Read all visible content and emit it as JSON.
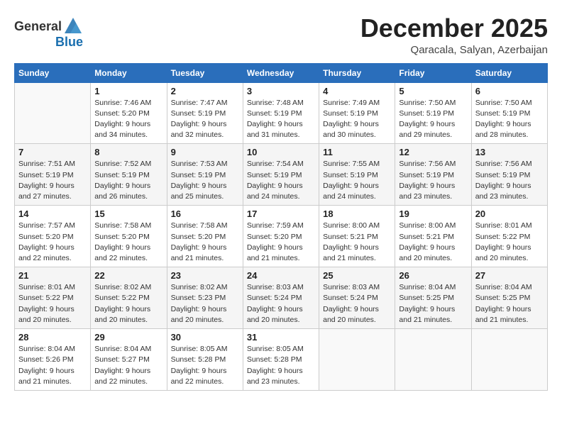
{
  "header": {
    "logo_general": "General",
    "logo_blue": "Blue",
    "month_title": "December 2025",
    "location": "Qaracala, Salyan, Azerbaijan"
  },
  "days_of_week": [
    "Sunday",
    "Monday",
    "Tuesday",
    "Wednesday",
    "Thursday",
    "Friday",
    "Saturday"
  ],
  "weeks": [
    {
      "days": [
        {
          "num": "",
          "info": ""
        },
        {
          "num": "1",
          "info": "Sunrise: 7:46 AM\nSunset: 5:20 PM\nDaylight: 9 hours\nand 34 minutes."
        },
        {
          "num": "2",
          "info": "Sunrise: 7:47 AM\nSunset: 5:19 PM\nDaylight: 9 hours\nand 32 minutes."
        },
        {
          "num": "3",
          "info": "Sunrise: 7:48 AM\nSunset: 5:19 PM\nDaylight: 9 hours\nand 31 minutes."
        },
        {
          "num": "4",
          "info": "Sunrise: 7:49 AM\nSunset: 5:19 PM\nDaylight: 9 hours\nand 30 minutes."
        },
        {
          "num": "5",
          "info": "Sunrise: 7:50 AM\nSunset: 5:19 PM\nDaylight: 9 hours\nand 29 minutes."
        },
        {
          "num": "6",
          "info": "Sunrise: 7:50 AM\nSunset: 5:19 PM\nDaylight: 9 hours\nand 28 minutes."
        }
      ]
    },
    {
      "days": [
        {
          "num": "7",
          "info": "Sunrise: 7:51 AM\nSunset: 5:19 PM\nDaylight: 9 hours\nand 27 minutes."
        },
        {
          "num": "8",
          "info": "Sunrise: 7:52 AM\nSunset: 5:19 PM\nDaylight: 9 hours\nand 26 minutes."
        },
        {
          "num": "9",
          "info": "Sunrise: 7:53 AM\nSunset: 5:19 PM\nDaylight: 9 hours\nand 25 minutes."
        },
        {
          "num": "10",
          "info": "Sunrise: 7:54 AM\nSunset: 5:19 PM\nDaylight: 9 hours\nand 24 minutes."
        },
        {
          "num": "11",
          "info": "Sunrise: 7:55 AM\nSunset: 5:19 PM\nDaylight: 9 hours\nand 24 minutes."
        },
        {
          "num": "12",
          "info": "Sunrise: 7:56 AM\nSunset: 5:19 PM\nDaylight: 9 hours\nand 23 minutes."
        },
        {
          "num": "13",
          "info": "Sunrise: 7:56 AM\nSunset: 5:19 PM\nDaylight: 9 hours\nand 23 minutes."
        }
      ]
    },
    {
      "days": [
        {
          "num": "14",
          "info": "Sunrise: 7:57 AM\nSunset: 5:20 PM\nDaylight: 9 hours\nand 22 minutes."
        },
        {
          "num": "15",
          "info": "Sunrise: 7:58 AM\nSunset: 5:20 PM\nDaylight: 9 hours\nand 22 minutes."
        },
        {
          "num": "16",
          "info": "Sunrise: 7:58 AM\nSunset: 5:20 PM\nDaylight: 9 hours\nand 21 minutes."
        },
        {
          "num": "17",
          "info": "Sunrise: 7:59 AM\nSunset: 5:20 PM\nDaylight: 9 hours\nand 21 minutes."
        },
        {
          "num": "18",
          "info": "Sunrise: 8:00 AM\nSunset: 5:21 PM\nDaylight: 9 hours\nand 21 minutes."
        },
        {
          "num": "19",
          "info": "Sunrise: 8:00 AM\nSunset: 5:21 PM\nDaylight: 9 hours\nand 20 minutes."
        },
        {
          "num": "20",
          "info": "Sunrise: 8:01 AM\nSunset: 5:22 PM\nDaylight: 9 hours\nand 20 minutes."
        }
      ]
    },
    {
      "days": [
        {
          "num": "21",
          "info": "Sunrise: 8:01 AM\nSunset: 5:22 PM\nDaylight: 9 hours\nand 20 minutes."
        },
        {
          "num": "22",
          "info": "Sunrise: 8:02 AM\nSunset: 5:22 PM\nDaylight: 9 hours\nand 20 minutes."
        },
        {
          "num": "23",
          "info": "Sunrise: 8:02 AM\nSunset: 5:23 PM\nDaylight: 9 hours\nand 20 minutes."
        },
        {
          "num": "24",
          "info": "Sunrise: 8:03 AM\nSunset: 5:24 PM\nDaylight: 9 hours\nand 20 minutes."
        },
        {
          "num": "25",
          "info": "Sunrise: 8:03 AM\nSunset: 5:24 PM\nDaylight: 9 hours\nand 20 minutes."
        },
        {
          "num": "26",
          "info": "Sunrise: 8:04 AM\nSunset: 5:25 PM\nDaylight: 9 hours\nand 21 minutes."
        },
        {
          "num": "27",
          "info": "Sunrise: 8:04 AM\nSunset: 5:25 PM\nDaylight: 9 hours\nand 21 minutes."
        }
      ]
    },
    {
      "days": [
        {
          "num": "28",
          "info": "Sunrise: 8:04 AM\nSunset: 5:26 PM\nDaylight: 9 hours\nand 21 minutes."
        },
        {
          "num": "29",
          "info": "Sunrise: 8:04 AM\nSunset: 5:27 PM\nDaylight: 9 hours\nand 22 minutes."
        },
        {
          "num": "30",
          "info": "Sunrise: 8:05 AM\nSunset: 5:28 PM\nDaylight: 9 hours\nand 22 minutes."
        },
        {
          "num": "31",
          "info": "Sunrise: 8:05 AM\nSunset: 5:28 PM\nDaylight: 9 hours\nand 23 minutes."
        },
        {
          "num": "",
          "info": ""
        },
        {
          "num": "",
          "info": ""
        },
        {
          "num": "",
          "info": ""
        }
      ]
    }
  ]
}
